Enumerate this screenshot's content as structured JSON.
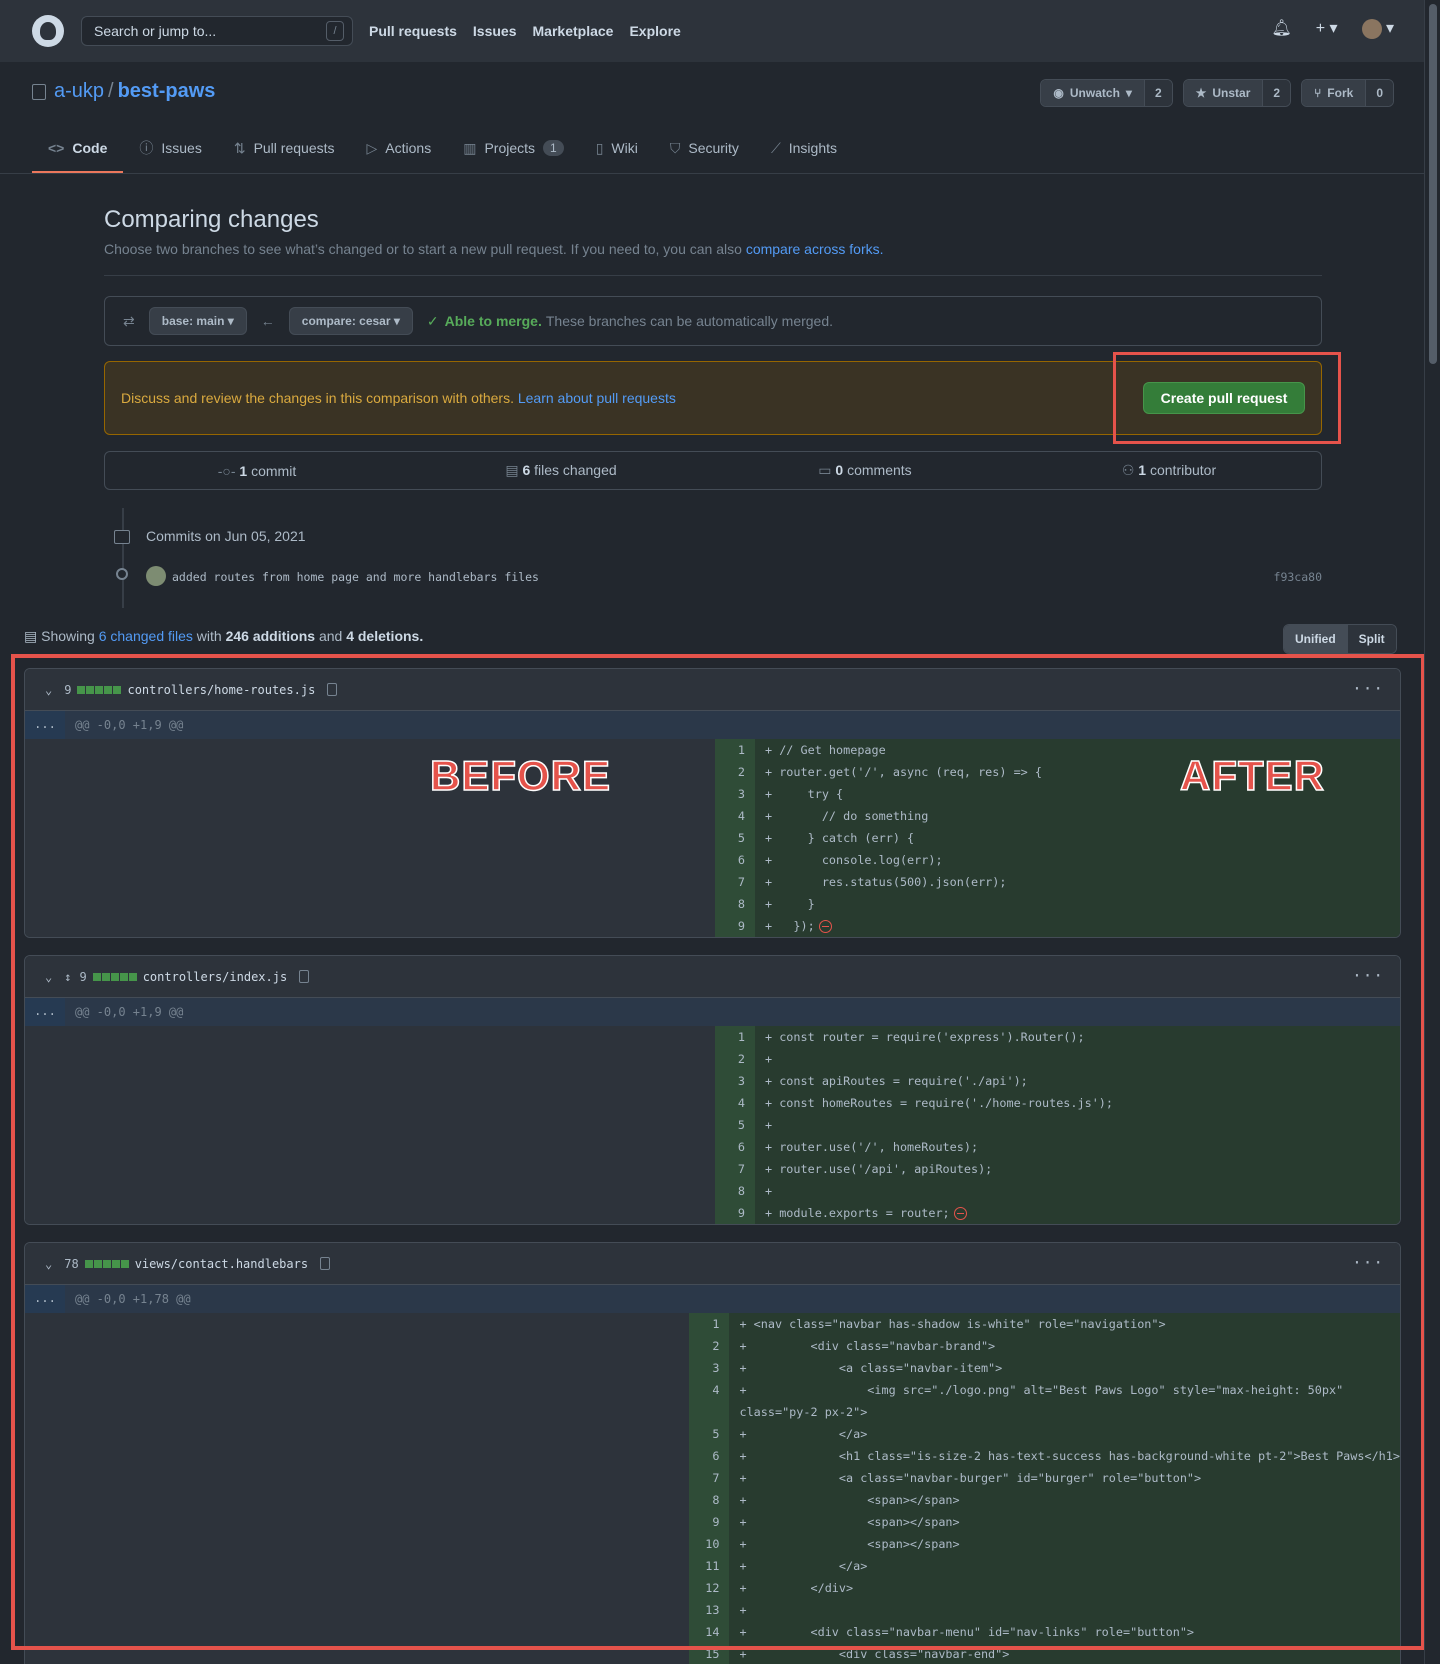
{
  "header": {
    "search_placeholder": "Search or jump to...",
    "search_key": "/",
    "nav": [
      "Pull requests",
      "Issues",
      "Marketplace",
      "Explore"
    ]
  },
  "repo": {
    "owner": "a-ukp",
    "name": "best-paws",
    "watch_label": "Unwatch",
    "watch_count": "2",
    "star_label": "Unstar",
    "star_count": "2",
    "fork_label": "Fork",
    "fork_count": "0",
    "tabs": [
      {
        "label": "Code",
        "icon": "code-icon"
      },
      {
        "label": "Issues",
        "icon": "issue-icon"
      },
      {
        "label": "Pull requests",
        "icon": "pull-request-icon"
      },
      {
        "label": "Actions",
        "icon": "play-icon"
      },
      {
        "label": "Projects",
        "icon": "project-icon",
        "count": "1"
      },
      {
        "label": "Wiki",
        "icon": "book-icon"
      },
      {
        "label": "Security",
        "icon": "shield-icon"
      },
      {
        "label": "Insights",
        "icon": "graph-icon"
      }
    ]
  },
  "compare": {
    "title": "Comparing changes",
    "subtitle": "Choose two branches to see what’s changed or to start a new pull request. If you need to, you can also",
    "subtitle_link": "compare across forks.",
    "base": "base: main",
    "compare_branch": "compare: cesar",
    "merge_status": "Able to merge.",
    "merge_text": "These branches can be automatically merged.",
    "flash_text": "Discuss and review the changes in this comparison with others.",
    "flash_link": "Learn about pull requests",
    "create_button": "Create pull request"
  },
  "summary": {
    "commits_count": "1",
    "commits_label": "commit",
    "files_count": "6",
    "files_label": "files changed",
    "comments_count": "0",
    "comments_label": "comments",
    "contributors_count": "1",
    "contributors_label": "contributor"
  },
  "commits": {
    "day": "Commits on Jun 05, 2021",
    "message": "added routes from home page and more handlebars files",
    "sha": "f93ca80"
  },
  "diffstat": {
    "showing": "Showing",
    "files_link": "6 changed files",
    "with": "with",
    "additions": "246 additions",
    "and": "and",
    "deletions": "4 deletions."
  },
  "view_toggle": {
    "unified": "Unified",
    "split": "Split"
  },
  "annotations": {
    "before": "BEFORE",
    "after": "AFTER"
  },
  "files": [
    {
      "count": "9",
      "name": "controllers/home-routes.js",
      "hunk": "@@ -0,0 +1,9 @@",
      "lines": [
        "+ // Get homepage",
        "+ router.get('/', async (req, res) => {",
        "+     try {",
        "+       // do something",
        "+     } catch (err) {",
        "+       console.log(err);",
        "+       res.status(500).json(err);",
        "+     }",
        "+   });"
      ]
    },
    {
      "count": "9",
      "name": "controllers/index.js",
      "hunk": "@@ -0,0 +1,9 @@",
      "lines": [
        "+ const router = require('express').Router();",
        "+",
        "+ const apiRoutes = require('./api');",
        "+ const homeRoutes = require('./home-routes.js');",
        "+",
        "+ router.use('/', homeRoutes);",
        "+ router.use('/api', apiRoutes);",
        "+",
        "+ module.exports = router;"
      ]
    },
    {
      "count": "78",
      "name": "views/contact.handlebars",
      "hunk": "@@ -0,0 +1,78 @@",
      "lines": [
        "+ <nav class=\"navbar has-shadow is-white\" role=\"navigation\">",
        "+         <div class=\"navbar-brand\">",
        "+             <a class=\"navbar-item\">",
        "+                 <img src=\"./logo.png\" alt=\"Best Paws Logo\" style=\"max-height: 50px\"",
        "class=\"py-2 px-2\">",
        "+             </a>",
        "+             <h1 class=\"is-size-2 has-text-success has-background-white pt-2\">Best Paws</h1>",
        "+             <a class=\"navbar-burger\" id=\"burger\" role=\"button\">",
        "+                 <span></span>",
        "+                 <span></span>",
        "+                 <span></span>",
        "+             </a>",
        "+         </div>",
        "+",
        "+         <div class=\"navbar-menu\" id=\"nav-links\" role=\"button\">",
        "+             <div class=\"navbar-end\">"
      ],
      "line_numbers": [
        "1",
        "2",
        "3",
        "4",
        "",
        "5",
        "6",
        "7",
        "8",
        "9",
        "10",
        "11",
        "12",
        "13",
        "14",
        "15"
      ]
    }
  ]
}
